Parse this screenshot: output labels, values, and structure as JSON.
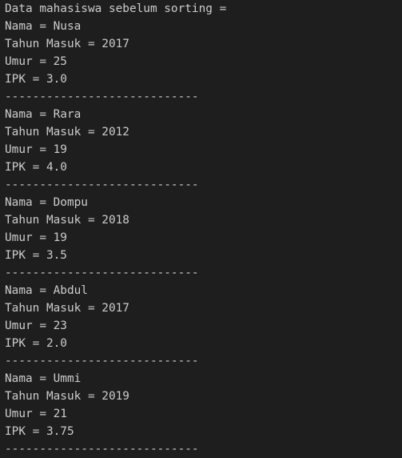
{
  "terminal": {
    "background": "#1e1e1e",
    "text_color": "#cccccc",
    "lines": [
      "Data mahasiswa sebelum sorting =",
      "Nama = Nusa",
      "Tahun Masuk = 2017",
      "Umur = 25",
      "IPK = 3.0",
      "----------------------------",
      "Nama = Rara",
      "Tahun Masuk = 2012",
      "Umur = 19",
      "IPK = 4.0",
      "----------------------------",
      "Nama = Dompu",
      "Tahun Masuk = 2018",
      "Umur = 19",
      "IPK = 3.5",
      "----------------------------",
      "Nama = Abdul",
      "Tahun Masuk = 2017",
      "Umur = 23",
      "IPK = 2.0",
      "----------------------------",
      "Nama = Ummi",
      "Tahun Masuk = 2019",
      "Umur = 21",
      "IPK = 3.75",
      "----------------------------"
    ]
  }
}
